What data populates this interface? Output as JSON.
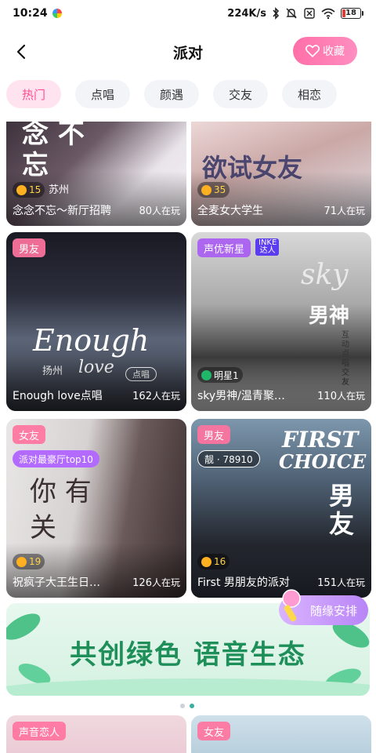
{
  "status_bar": {
    "time": "10:24",
    "network_speed": "224K/s",
    "battery_level": "18",
    "icons": [
      "bluetooth-icon",
      "mute-icon",
      "sim-off-icon",
      "wifi-icon",
      "battery-icon"
    ]
  },
  "header": {
    "title": "派对",
    "favorite_label": "收藏",
    "back_icon": "chevron-left-icon",
    "favorite_icon": "heart-icon"
  },
  "tabs": [
    {
      "label": "热门",
      "active": true
    },
    {
      "label": "点唱",
      "active": false
    },
    {
      "label": "颜遇",
      "active": false
    },
    {
      "label": "交友",
      "active": false
    },
    {
      "label": "相恋",
      "active": false
    }
  ],
  "rooms": [
    {
      "title": "念念不忘～新厅招聘",
      "count": "80",
      "count_suffix": "人在玩",
      "badge_level": "15",
      "badge_text": "苏州",
      "overlay": "念 不忘"
    },
    {
      "title": "全麦女大学生",
      "count": "71",
      "count_suffix": "人在玩",
      "badge_level": "35",
      "overlay": "欲试女友"
    },
    {
      "title": "Enough love点唱",
      "count": "162",
      "count_suffix": "人在玩",
      "tag": "男友",
      "overlay_main": "Enough",
      "overlay_sub": "扬州",
      "overlay_love": "love",
      "overlay_chip": "点唱"
    },
    {
      "title": "sky男神/温青聚…",
      "count": "110",
      "count_suffix": "人在玩",
      "tag": "声优新星",
      "tag_logo": "INKE 达人",
      "badge_text": "明星1",
      "overlay_main": "sky",
      "overlay_sub": "男神",
      "overlay_side": "互动点唱交友"
    },
    {
      "title": "祝疯子大王生日…",
      "count": "126",
      "count_suffix": "人在玩",
      "tag": "女友",
      "chip": "派对最豪厅top10",
      "badge_level": "19",
      "overlay": "你 有关"
    },
    {
      "title": "First 男朋友的派对",
      "count": "151",
      "count_suffix": "人在玩",
      "tag": "男友",
      "chip": "靓 · 78910",
      "badge_level": "16",
      "overlay_main": "FIRST",
      "overlay_sub": "CHOICE",
      "overlay_side": "男友"
    }
  ],
  "banner": {
    "text": "共创绿色 语音生态",
    "random_label": "随缘安排",
    "pages": 2,
    "active_page": 2
  },
  "next_row": {
    "left_tag": "声音恋人",
    "right_tag": "女友"
  },
  "colors": {
    "accent_pink": "#ff4d8d",
    "tag_pink": "#ff74a0",
    "tag_purple": "#a85cf2",
    "banner_green": "#1f8f5a"
  }
}
